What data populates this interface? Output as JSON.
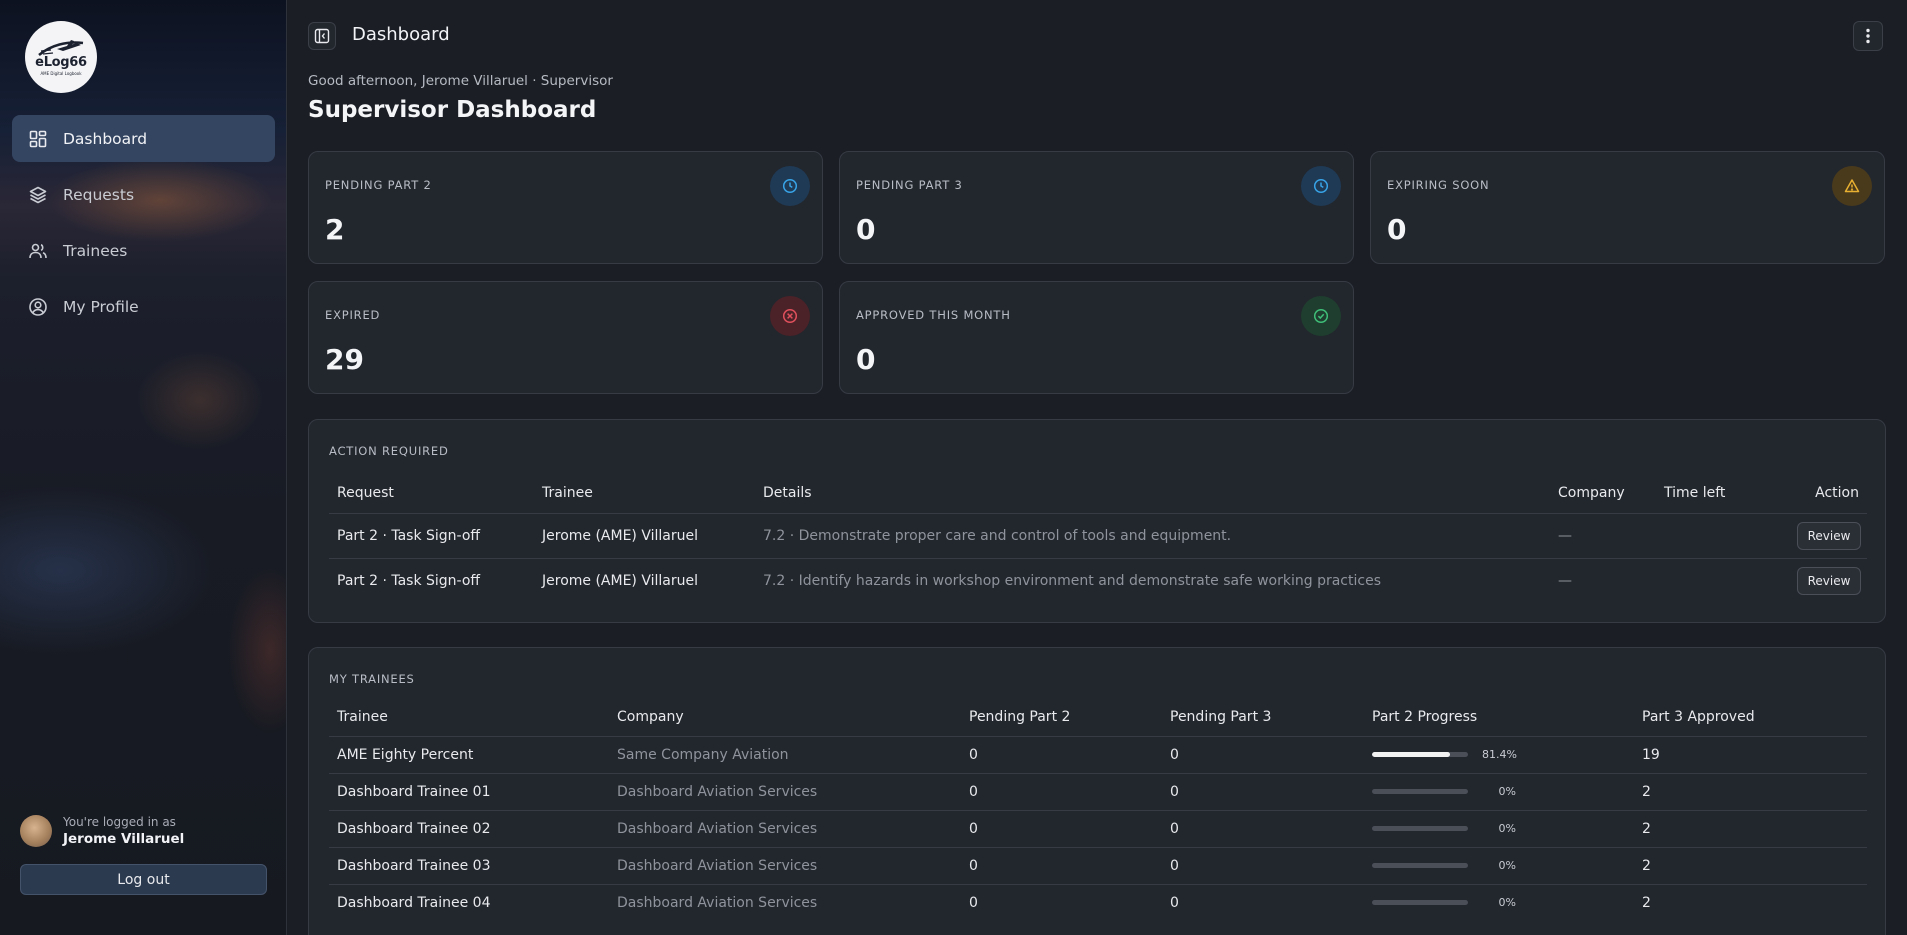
{
  "brand": {
    "logo_text": "eLog66",
    "logo_sub": "AME Digital Logbook"
  },
  "sidebar": {
    "items": [
      {
        "label": "Dashboard",
        "icon": "dashboard-icon",
        "active": true
      },
      {
        "label": "Requests",
        "icon": "layers-icon",
        "active": false
      },
      {
        "label": "Trainees",
        "icon": "users-icon",
        "active": false
      },
      {
        "label": "My Profile",
        "icon": "user-circle-icon",
        "active": false
      }
    ],
    "logged_in_label": "You're logged in as",
    "user_name": "Jerome Villaruel",
    "logout_label": "Log out"
  },
  "header": {
    "title": "Dashboard",
    "greeting": "Good afternoon, Jerome Villaruel · Supervisor",
    "page_title": "Supervisor Dashboard"
  },
  "stats": [
    {
      "label": "Pending Part 2",
      "value": "2",
      "icon": "clock-icon",
      "color": "#38a4e8"
    },
    {
      "label": "Pending Part 3",
      "value": "0",
      "icon": "clock-icon",
      "color": "#38a4e8"
    },
    {
      "label": "Expiring Soon",
      "value": "0",
      "icon": "warning-icon",
      "color": "#e8b030"
    },
    {
      "label": "Expired",
      "value": "29",
      "icon": "x-circle-icon",
      "color": "#e0505c"
    },
    {
      "label": "Approved This Month",
      "value": "0",
      "icon": "check-circle-icon",
      "color": "#3fbf78"
    }
  ],
  "action_required": {
    "title": "Action Required",
    "columns": [
      "Request",
      "Trainee",
      "Details",
      "Company",
      "Time left",
      "Action"
    ],
    "rows": [
      {
        "request": "Part 2 · Task Sign-off",
        "trainee": "Jerome (AME) Villaruel",
        "details": "7.2 · Demonstrate proper care and control of tools and equipment.",
        "company": "—",
        "time_left": "",
        "action": "Review"
      },
      {
        "request": "Part 2 · Task Sign-off",
        "trainee": "Jerome (AME) Villaruel",
        "details": "7.2 · Identify hazards in workshop environment and demonstrate safe working practices",
        "company": "—",
        "time_left": "",
        "action": "Review"
      }
    ]
  },
  "my_trainees": {
    "title": "My Trainees",
    "columns": [
      "Trainee",
      "Company",
      "Pending Part 2",
      "Pending Part 3",
      "Part 2 Progress",
      "Part 3 Approved"
    ],
    "rows": [
      {
        "trainee": "AME Eighty Percent",
        "company": "Same Company Aviation",
        "p2": "0",
        "p3": "0",
        "progress": 0.814,
        "progress_label": "81.4%",
        "approved": "19"
      },
      {
        "trainee": "Dashboard Trainee 01",
        "company": "Dashboard Aviation Services",
        "p2": "0",
        "p3": "0",
        "progress": 0,
        "progress_label": "0%",
        "approved": "2"
      },
      {
        "trainee": "Dashboard Trainee 02",
        "company": "Dashboard Aviation Services",
        "p2": "0",
        "p3": "0",
        "progress": 0,
        "progress_label": "0%",
        "approved": "2"
      },
      {
        "trainee": "Dashboard Trainee 03",
        "company": "Dashboard Aviation Services",
        "p2": "0",
        "p3": "0",
        "progress": 0,
        "progress_label": "0%",
        "approved": "2"
      },
      {
        "trainee": "Dashboard Trainee 04",
        "company": "Dashboard Aviation Services",
        "p2": "0",
        "p3": "0",
        "progress": 0,
        "progress_label": "0%",
        "approved": "2"
      }
    ]
  }
}
